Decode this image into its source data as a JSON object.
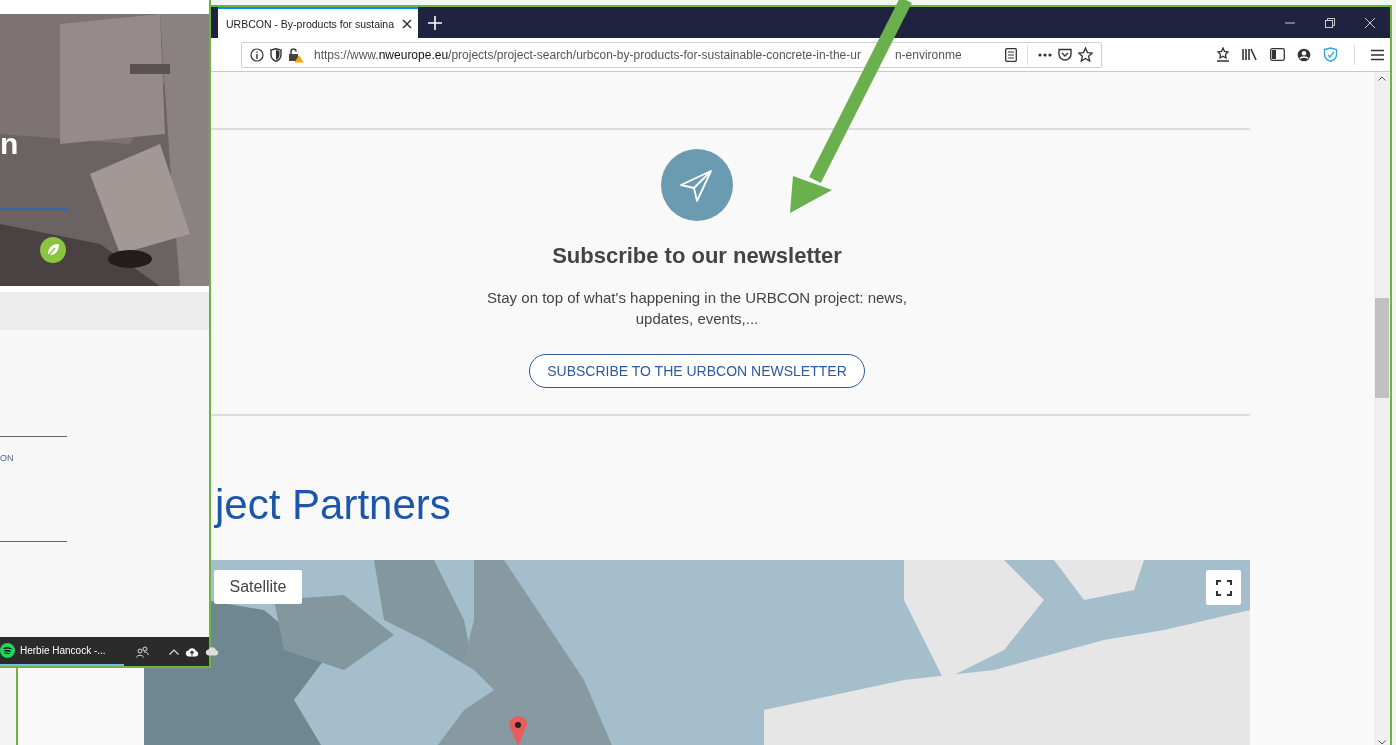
{
  "left_window": {
    "heading_fragment": "n",
    "label_fragment": "ON",
    "taskbar": {
      "media_title": "Herbie Hancock -..."
    }
  },
  "browser": {
    "tabs": [
      {
        "title": "URBCON - By-products for sustaina",
        "selected": true
      }
    ],
    "url": {
      "prefix": "https://www.",
      "domain": "nweurope.eu",
      "path": "/projects/project-search/urbcon-by-products-for-sustainable-concrete-in-the-ur",
      "path_after_arrow": "n-environme"
    },
    "newsletter": {
      "title": "Subscribe to our newsletter",
      "text": "Stay on top of what's happening in the URBCON project: news, updates, events,...",
      "button": "SUBSCRIBE TO THE URBCON NEWSLETTER"
    },
    "section_heading": "ject Partners",
    "map": {
      "kind": "picture",
      "map_type_button": "Satellite"
    }
  }
}
